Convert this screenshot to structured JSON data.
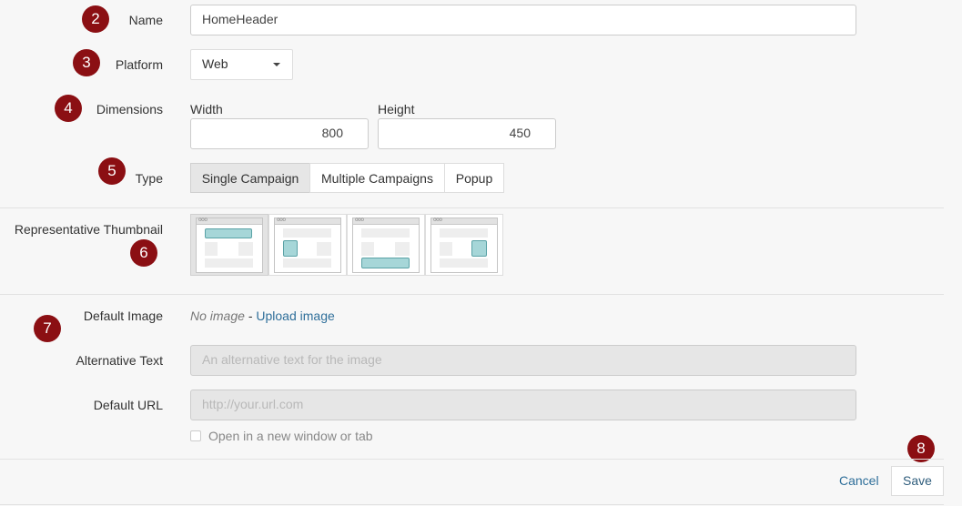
{
  "steps": [
    "2",
    "3",
    "4",
    "5",
    "6",
    "7",
    "8"
  ],
  "form": {
    "name_label": "Name",
    "name_value": "HomeHeader",
    "platform_label": "Platform",
    "platform_value": "Web",
    "dimensions_label": "Dimensions",
    "width_label": "Width",
    "width_value": "800",
    "height_label": "Height",
    "height_value": "450",
    "type_label": "Type",
    "type_options": [
      "Single Campaign",
      "Multiple Campaigns",
      "Popup"
    ],
    "type_selected": "Single Campaign",
    "thumbnail_label": "Representative Thumbnail",
    "thumbnails": [
      "top-banner",
      "left-box",
      "bottom-banner",
      "right-box"
    ],
    "default_image_label": "Default Image",
    "no_image_text": "No image",
    "separator": "-",
    "upload_link": "Upload image",
    "alt_text_label": "Alternative Text",
    "alt_text_placeholder": "An alternative text for the image",
    "default_url_label": "Default URL",
    "default_url_placeholder": "http://your.url.com",
    "new_window_label": "Open in a new window or tab",
    "new_window_checked": false
  },
  "footer": {
    "cancel_label": "Cancel",
    "save_label": "Save"
  },
  "colors": {
    "badge": "#8b0f13",
    "link": "#2f6f9a",
    "thumbnail_highlight": "#a6d6d8"
  }
}
